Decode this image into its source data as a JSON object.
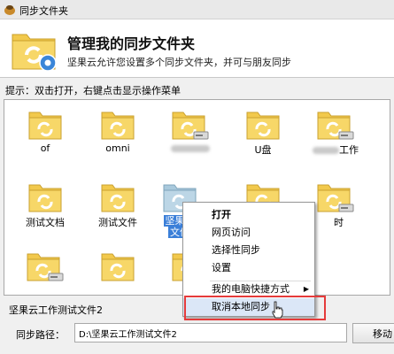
{
  "window": {
    "title": "同步文件夹",
    "accent": "#3b7fd8"
  },
  "header": {
    "title": "管理我的同步文件夹",
    "subtitle": "坚果云允许您设置多个同步文件夹，并可与朋友同步"
  },
  "hint": "提示：双击打开，右键点击显示操作菜单",
  "folders": [
    {
      "label": "of",
      "badge": false
    },
    {
      "label": "omni",
      "badge": false
    },
    {
      "label": "",
      "badge": true,
      "obscured": true
    },
    {
      "label": "U盘",
      "badge": false
    },
    {
      "label": "工作",
      "badge": true,
      "obscured_prefix": true
    },
    {
      "label": "测试文档",
      "badge": false
    },
    {
      "label": "测试文件",
      "badge": false
    },
    {
      "label_line1": "坚果云",
      "label_line2": "文件",
      "selected": true
    },
    {
      "label": "",
      "badge": false
    },
    {
      "label": "时",
      "badge": true
    },
    {
      "label": "",
      "badge": true
    },
    {
      "label": "",
      "badge": false
    },
    {
      "label": "",
      "badge": true
    }
  ],
  "context_menu": {
    "items": [
      {
        "label": "打开",
        "bold": true
      },
      {
        "label": "网页访问"
      },
      {
        "label": "选择性同步"
      },
      {
        "label": "设置"
      },
      {
        "label": "我的电脑快捷方式",
        "submenu": true
      },
      {
        "label": "取消本地同步",
        "highlighted": true
      }
    ],
    "highlight_color": "#e53b3b"
  },
  "bottom": {
    "section_title": "坚果云工作测试文件2",
    "path_label": "同步路径：",
    "path_value": "D:\\坚果云工作测试文件2",
    "move_button": "移动"
  }
}
